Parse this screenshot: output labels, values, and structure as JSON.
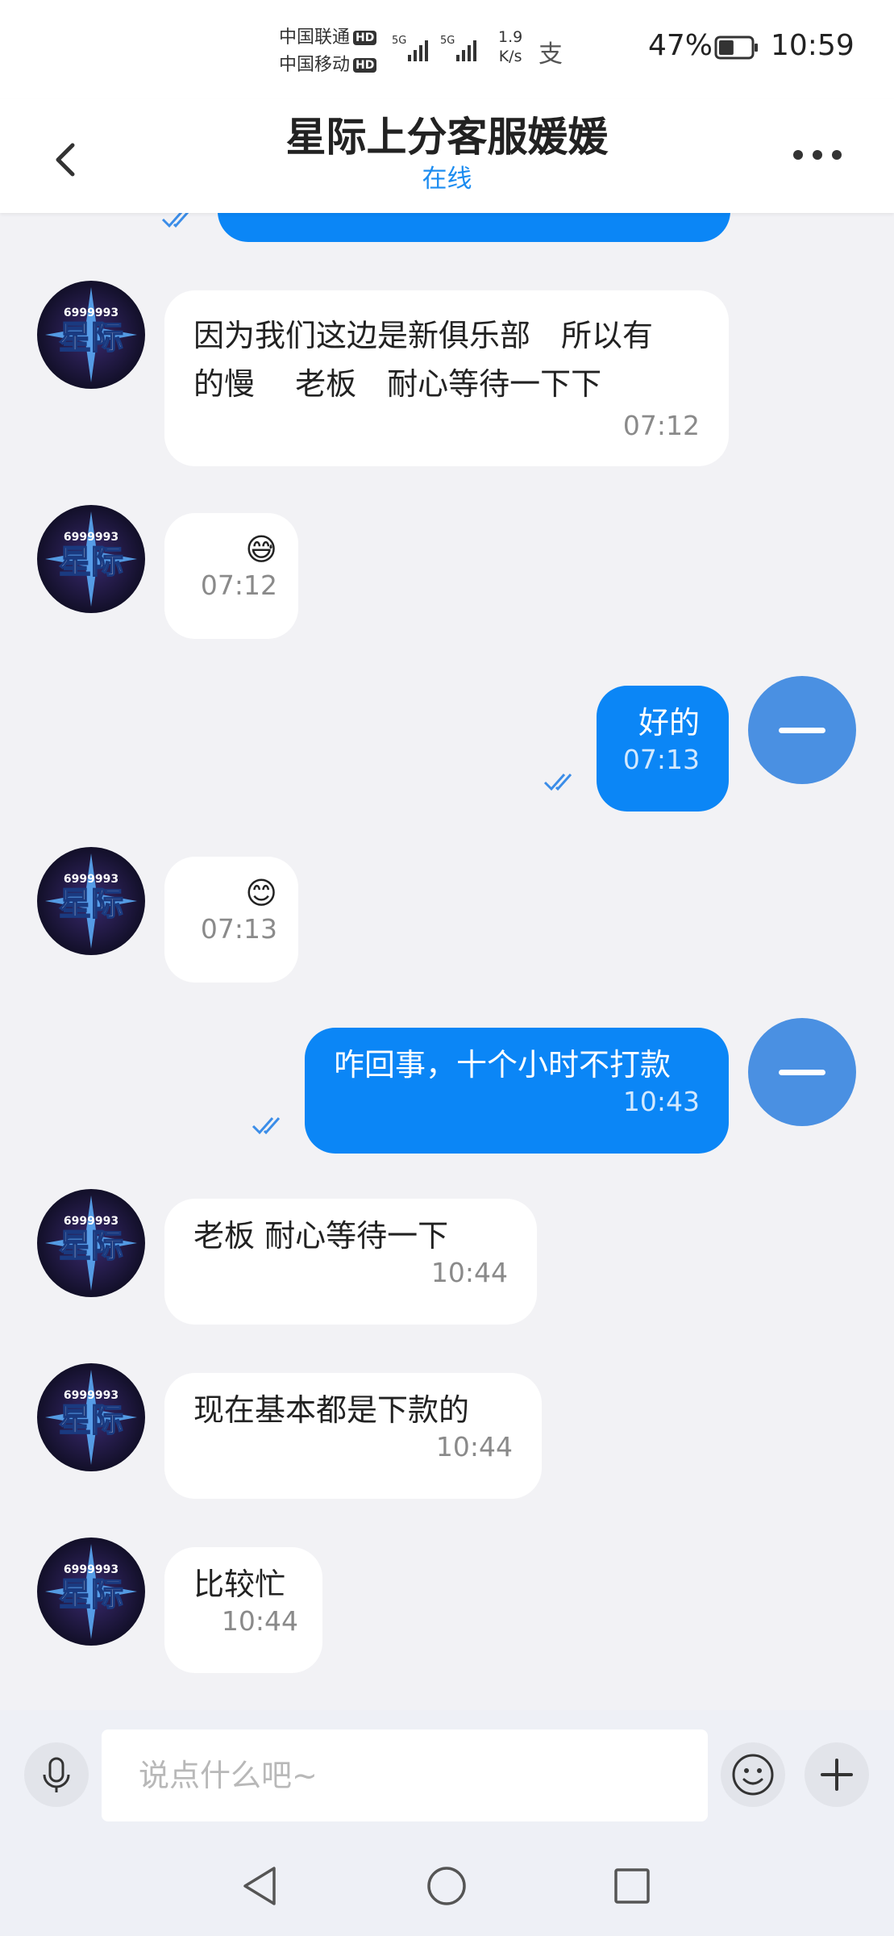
{
  "status_bar": {
    "carrier_1": "中国联通",
    "carrier_2": "中国移动",
    "hd": "HD",
    "net_1": "5G",
    "net_2": "5G",
    "speed_value": "1.9",
    "speed_unit": "K/s",
    "battery_percent": "47%",
    "battery_level": 0.47,
    "time": "10:59"
  },
  "header": {
    "title": "星际上分客服媛媛",
    "subtitle": "在线"
  },
  "avatar": {
    "number_text": "6999993",
    "name_text": "星际"
  },
  "messages": [
    {
      "side": "in",
      "text_line_1": "因为我们这边是新俱乐部　所以有",
      "text_line_2": "的慢　 老板　耐心等待一下下",
      "time": "07:12"
    },
    {
      "side": "in",
      "text": "😅",
      "time": "07:12"
    },
    {
      "side": "out",
      "text": "好的",
      "time": "07:13"
    },
    {
      "side": "in",
      "text": "😊",
      "time": "07:13"
    },
    {
      "side": "out",
      "text": "咋回事，十个小时不打款",
      "time": "10:43"
    },
    {
      "side": "in",
      "text": "老板 耐心等待一下",
      "time": "10:44"
    },
    {
      "side": "in",
      "text": "现在基本都是下款的",
      "time": "10:44"
    },
    {
      "side": "in",
      "text": "比较忙",
      "time": "10:44"
    }
  ],
  "input": {
    "placeholder": "说点什么吧~"
  },
  "icons": {
    "back": "chevron-left-icon",
    "more": "more-dots-icon",
    "mic": "mic-icon",
    "emoji": "emoji-icon",
    "add": "plus-icon",
    "nav_back": "triangle-back-icon",
    "nav_home": "circle-home-icon",
    "nav_recent": "square-recent-icon"
  },
  "colors": {
    "accent": "#0b86f6",
    "online": "#1c8cf0",
    "minus_avatar": "#4a90e2",
    "background": "#f2f2f5"
  }
}
